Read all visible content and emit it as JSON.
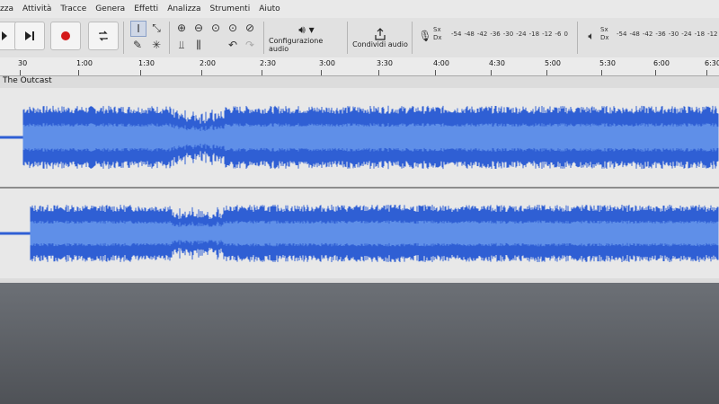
{
  "menu": [
    "zza",
    "Attività",
    "Tracce",
    "Genera",
    "Effetti",
    "Analizza",
    "Strumenti",
    "Aiuto"
  ],
  "toolbar": {
    "audio_setup_label": "Configurazione audio",
    "share_audio_label": "Condividi audio",
    "record_meter": {
      "channels": [
        "Sx",
        "Dx"
      ],
      "scale": [
        "-54",
        "-48",
        "-42",
        "-36",
        "-30",
        "-24",
        "-18",
        "-12",
        "-6",
        "0"
      ]
    },
    "playback_meter": {
      "channels": [
        "Sx",
        "Dx"
      ],
      "scale": [
        "-54",
        "-48",
        "-42",
        "-36",
        "-30",
        "-24",
        "-18",
        "-12",
        "-6"
      ]
    }
  },
  "ruler": {
    "labels": [
      "30",
      "1:00",
      "1:30",
      "2:00",
      "2:30",
      "3:00",
      "3:30",
      "4:00",
      "4:30",
      "5:00",
      "5:30",
      "6:00",
      "6:30"
    ]
  },
  "track": {
    "name": "The Outcast"
  },
  "colors": {
    "waveform": "#2f5fd4",
    "waveform_rms": "#5f8fe8",
    "track_bg": "#e8e8e8",
    "record_button": "#d41a1a"
  }
}
